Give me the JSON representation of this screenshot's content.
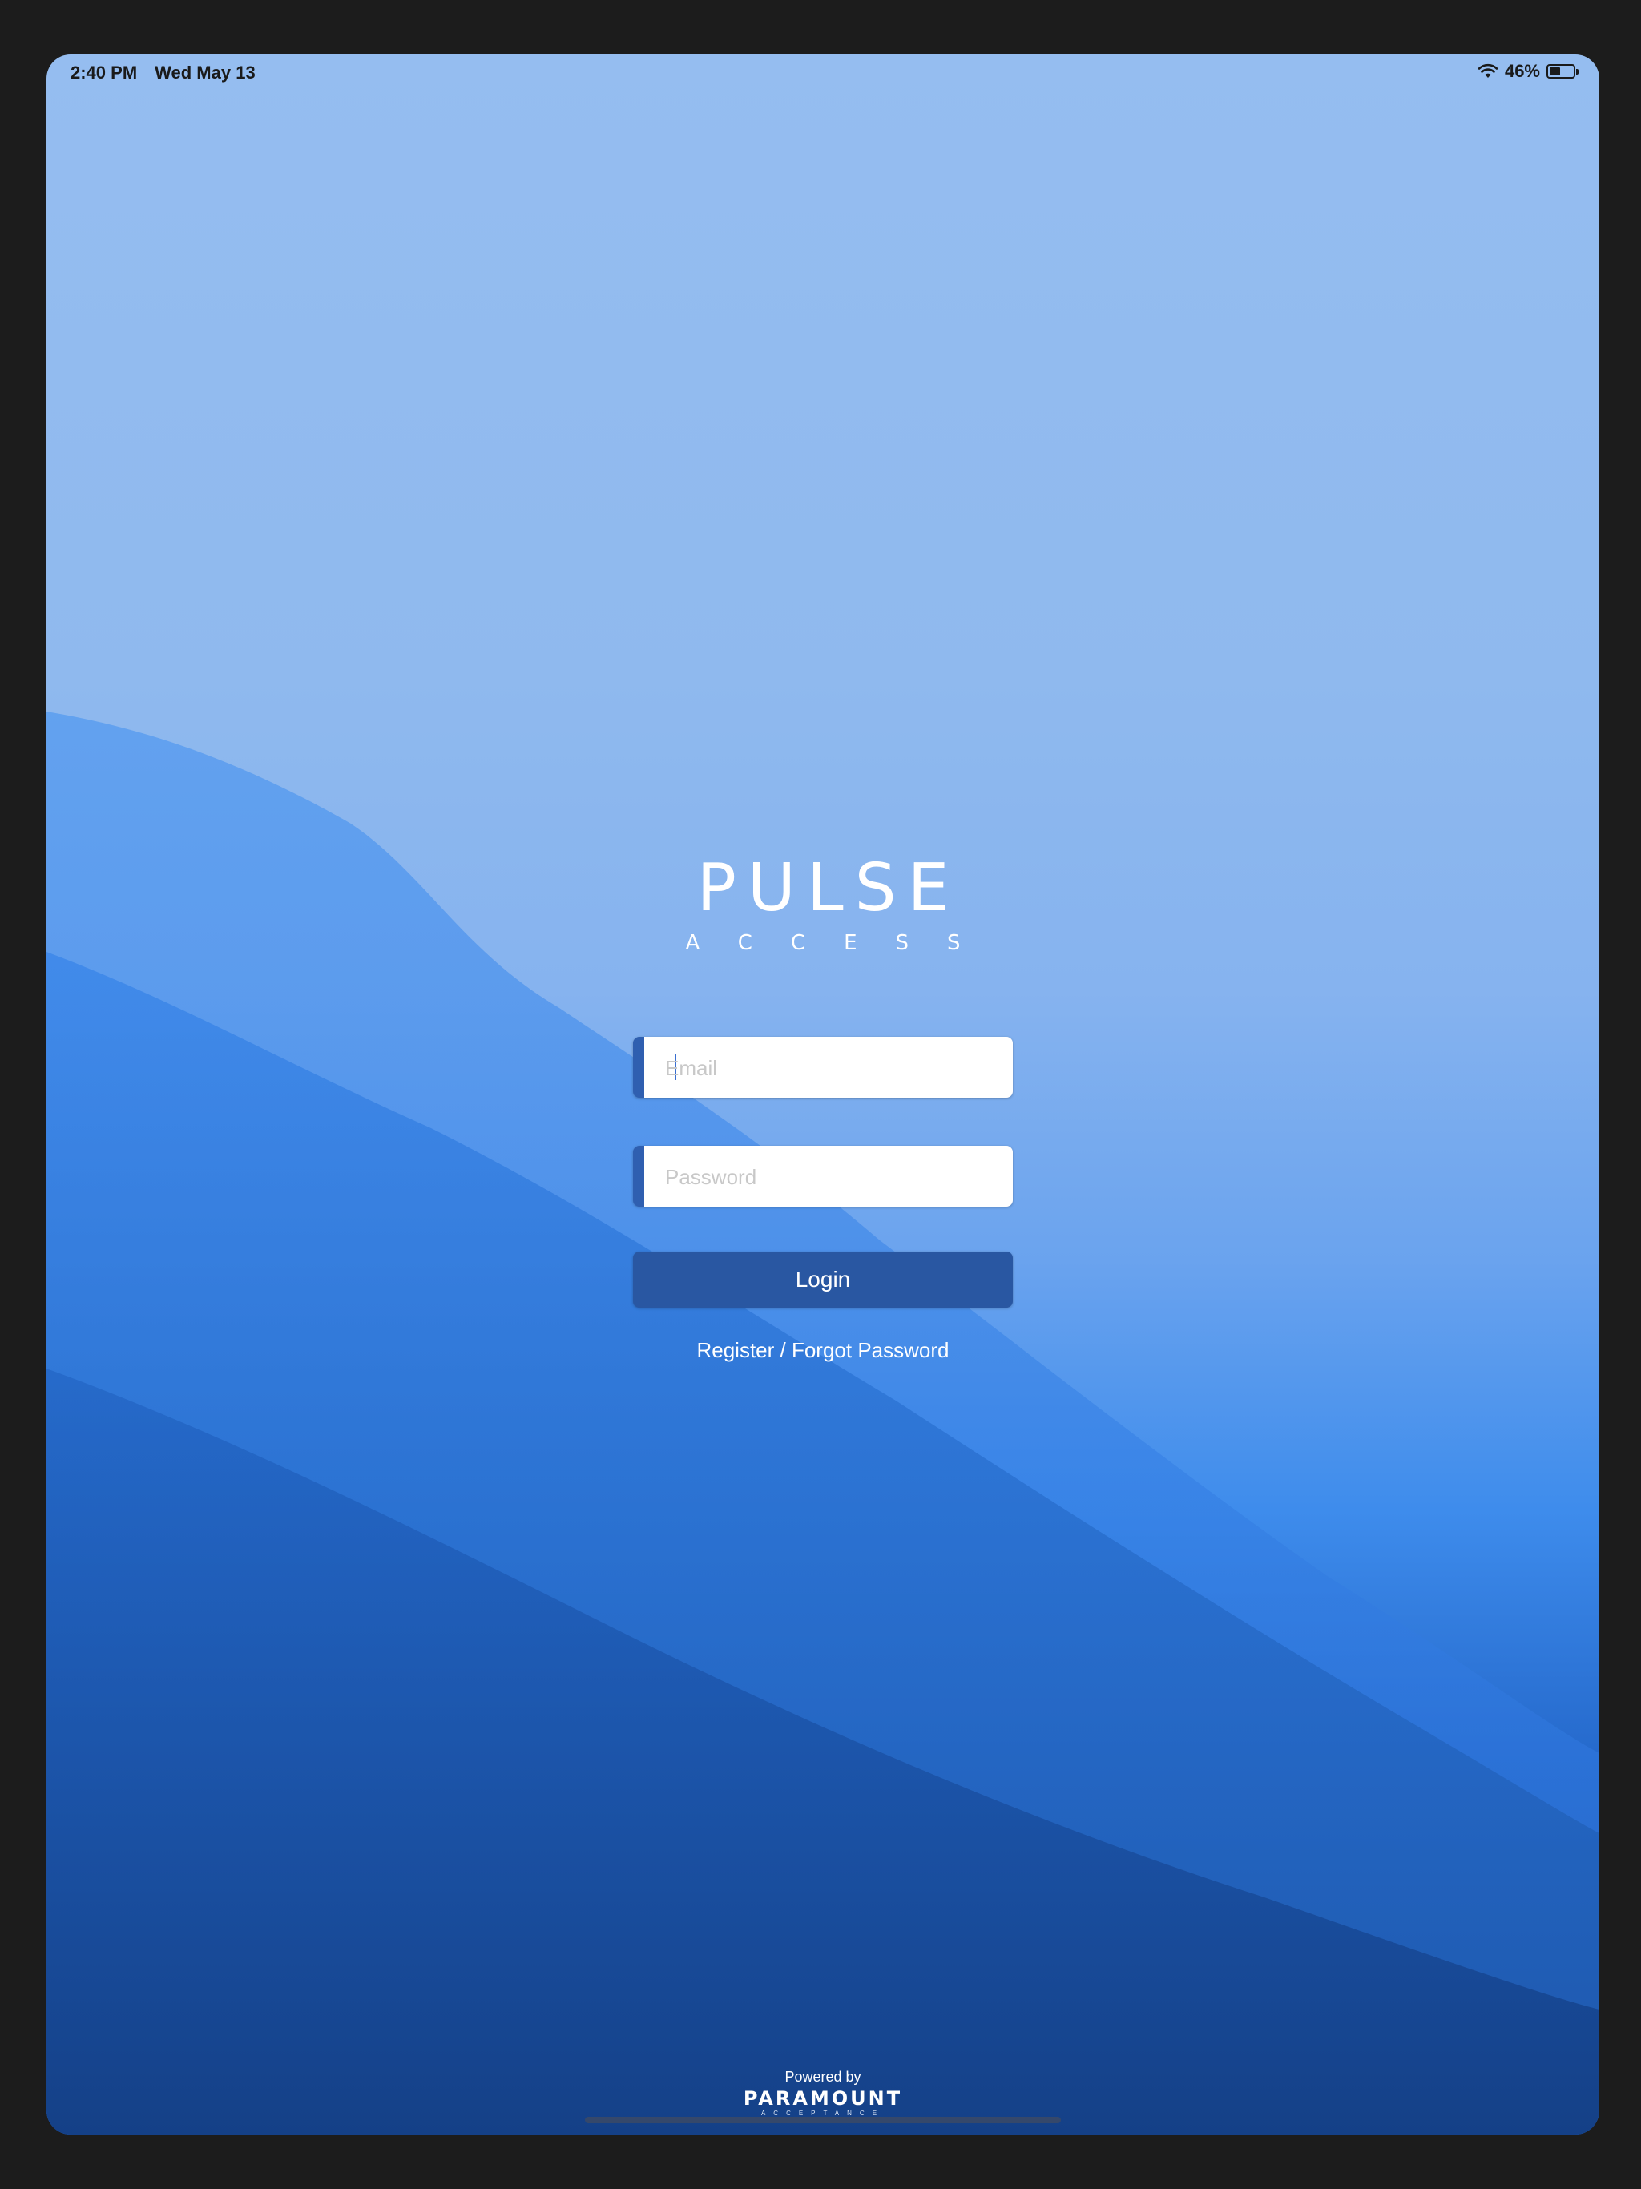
{
  "status_bar": {
    "time": "2:40 PM",
    "date": "Wed May 13",
    "battery_percent": "46%",
    "battery_level": 0.46,
    "wifi_icon": "wifi-icon",
    "battery_icon": "battery-icon"
  },
  "logo": {
    "main": "PULSE",
    "sub": "ACCESS"
  },
  "form": {
    "email_placeholder": "Email",
    "password_placeholder": "Password",
    "login_label": "Login",
    "register_link": "Register / Forgot Password"
  },
  "footer": {
    "powered_by": "Powered by",
    "brand": "PARAMOUNT",
    "brand_sub": "ACCEPTANCE"
  },
  "colors": {
    "field_accent": "#2f5fb0",
    "login_button": "#2957a2",
    "bezel": "#1c1c1c"
  }
}
